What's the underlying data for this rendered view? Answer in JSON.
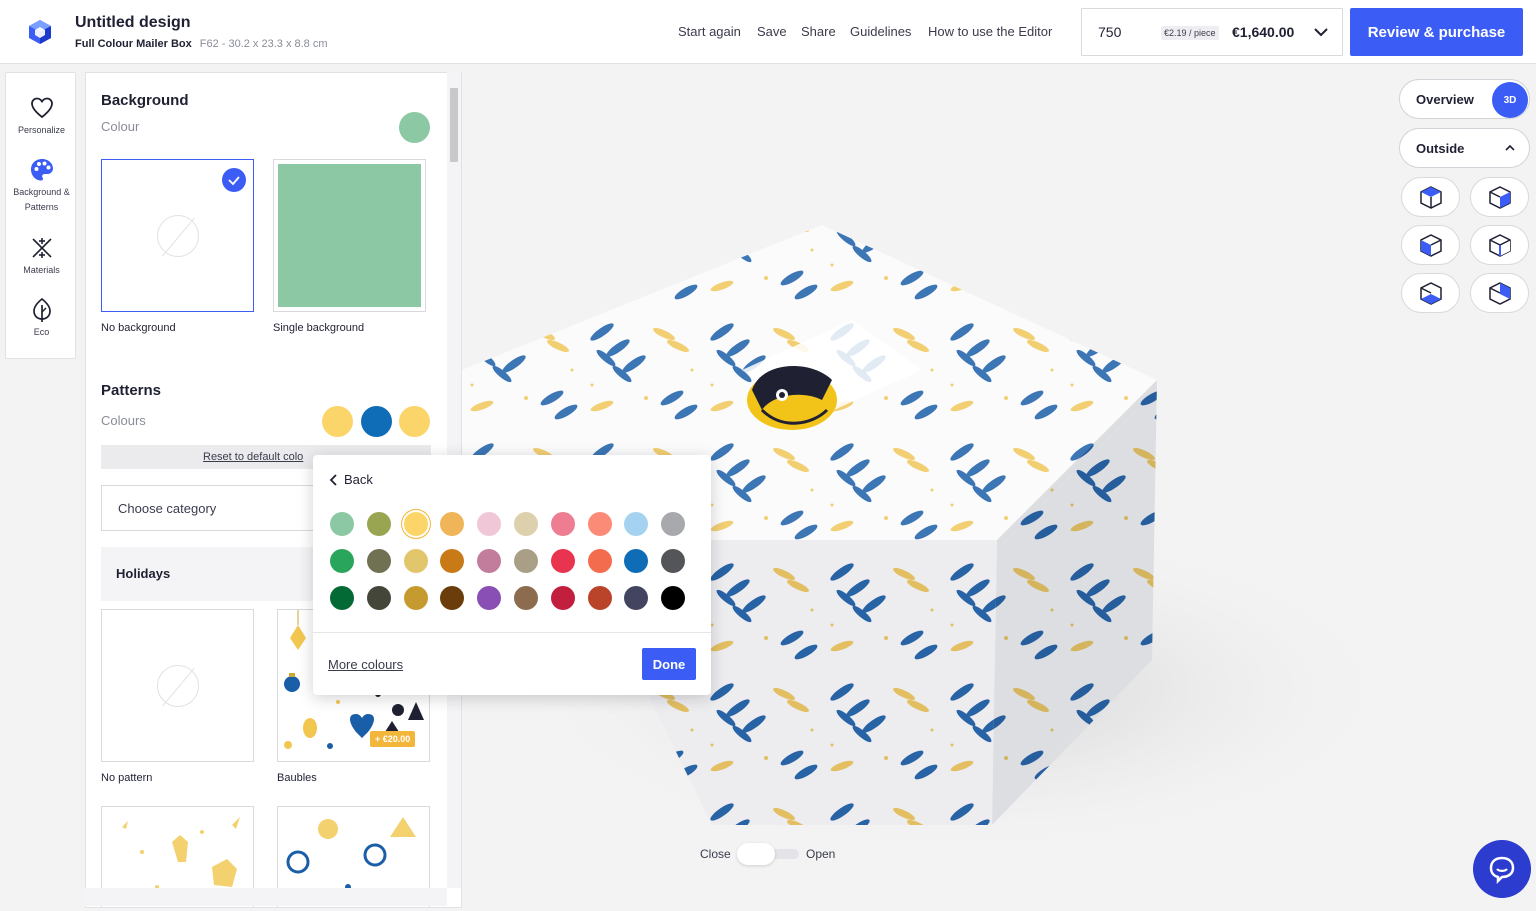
{
  "header": {
    "title": "Untitled design",
    "product": "Full Colour Mailer Box",
    "spec": "F62 - 30.2 x 23.3 x 8.8 cm",
    "nav": [
      "Start again",
      "Save",
      "Share",
      "Guidelines",
      "How to use the Editor"
    ],
    "quantity": "750",
    "per_piece": "€2.19 / piece",
    "total": "€1,640.00",
    "review_button": "Review & purchase"
  },
  "rail": {
    "items": [
      {
        "label": "Personalize",
        "icon": "heart-icon"
      },
      {
        "label": "Background & Patterns",
        "icon": "palette-icon"
      },
      {
        "label": "Materials",
        "icon": "materials-icon"
      },
      {
        "label": "Eco",
        "icon": "leaf-icon"
      }
    ]
  },
  "panel": {
    "background_title": "Background",
    "colour_label": "Colour",
    "background_colour": "#8cc8a4",
    "options": [
      {
        "label": "No background",
        "selected": true
      },
      {
        "label": "Single background",
        "selected": false
      }
    ],
    "patterns_title": "Patterns",
    "colours_label": "Colours",
    "pattern_colours": [
      "#fcd56a",
      "#0f6cb6",
      "#fcd56a"
    ],
    "reset_link": "Reset to default colo",
    "category_placeholder": "Choose category",
    "holidays_label": "Holidays",
    "pattern_cards": [
      {
        "label": "No pattern"
      },
      {
        "label": "Baubles",
        "price": "+ €20.00"
      }
    ]
  },
  "popup": {
    "back_label": "Back",
    "selected_colour": "#fcd56a",
    "colours": [
      [
        "#8cc8a4",
        "#9aa552",
        "#fcd56a",
        "#efb558",
        "#f0c7d6",
        "#ddd0ac",
        "#ef7d91",
        "#fb8a76",
        "#a6d2f1",
        "#a7a9ad"
      ],
      [
        "#2aa65c",
        "#707052",
        "#e2c66b",
        "#c87a16",
        "#c27d9c",
        "#a99f86",
        "#e9344f",
        "#f26c4d",
        "#0f6cb6",
        "#545559"
      ],
      [
        "#046a35",
        "#45463a",
        "#c59b30",
        "#6b3d0a",
        "#8a4fb5",
        "#8d6b4f",
        "#c21f3e",
        "#b9442a",
        "#434560",
        "#000000"
      ]
    ],
    "more_colours": "More colours",
    "done_label": "Done"
  },
  "view": {
    "overview_label": "Overview",
    "mode_3d": "3D",
    "outside_label": "Outside",
    "views": [
      "cube-view-1",
      "cube-view-2",
      "cube-view-3",
      "cube-view-4",
      "cube-view-5",
      "cube-view-6"
    ]
  },
  "toggle": {
    "close_label": "Close",
    "open_label": "Open"
  },
  "colors": {
    "accent": "#3b5cf5",
    "chat": "#2b3ccf",
    "leaf_blue": "#1b5ea8",
    "leaf_yellow": "#f0c75a",
    "mascot_yellow": "#f2c318"
  }
}
